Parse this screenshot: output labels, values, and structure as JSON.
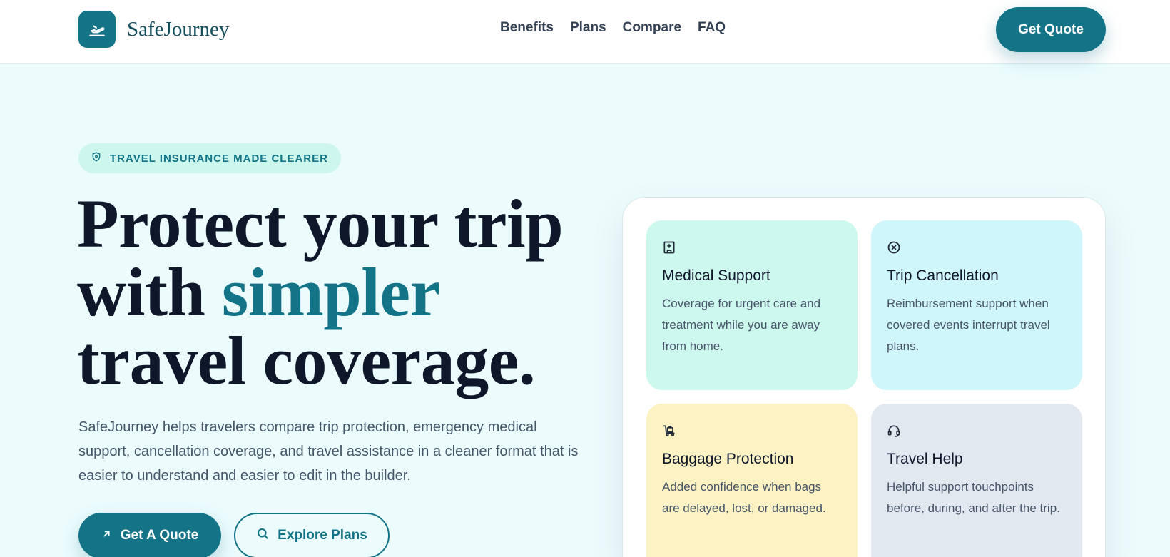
{
  "header": {
    "brand": "SafeJourney",
    "nav": [
      "Benefits",
      "Plans",
      "Compare",
      "FAQ"
    ],
    "cta": "Get Quote"
  },
  "hero": {
    "badge": "TRAVEL INSURANCE MADE CLEARER",
    "headline_line1": "Protect your trip",
    "headline_with": "with ",
    "headline_accent": "simpler",
    "headline_line3": "travel coverage.",
    "lead": "SafeJourney helps travelers compare trip protection, emergency medical support, cancellation coverage, and travel assistance in a cleaner format that is easier to understand and easier to edit in the builder.",
    "primary_button": "Get A Quote",
    "secondary_button": "Explore Plans"
  },
  "cards": [
    {
      "title": "Medical Support",
      "text": "Coverage for urgent care and treatment while you are away from home.",
      "icon": "hospital-icon"
    },
    {
      "title": "Trip Cancellation",
      "text": "Reimbursement support when covered events interrupt travel plans.",
      "icon": "cancel-circle-icon"
    },
    {
      "title": "Baggage Protection",
      "text": "Added confidence when bags are delayed, lost, or damaged.",
      "icon": "luggage-cart-icon"
    },
    {
      "title": "Travel Help",
      "text": "Helpful support touchpoints before, during, and after the trip.",
      "icon": "headset-icon"
    }
  ],
  "colors": {
    "brand": "#137487",
    "background": "#ecfcfd"
  }
}
